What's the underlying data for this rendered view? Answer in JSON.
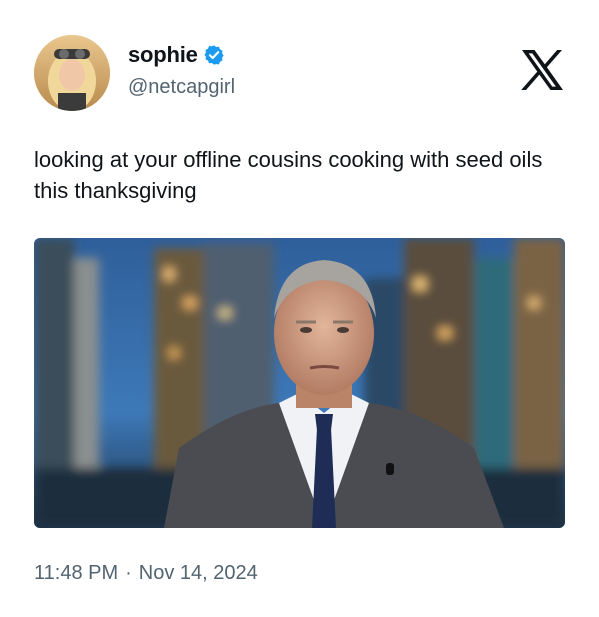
{
  "author": {
    "display_name": "sophie",
    "handle": "@netcapgirl",
    "verified_icon": "verified-badge-icon",
    "avatar_icon": "avatar-image"
  },
  "platform": {
    "logo_icon": "x-logo-icon"
  },
  "tweet": {
    "text": "looking at your offline cousins cooking with seed oils this thanksgiving"
  },
  "media": {
    "type": "photo"
  },
  "meta": {
    "time": "11:48 PM",
    "separator": "·",
    "date": "Nov 14, 2024"
  },
  "colors": {
    "text": "#0f1419",
    "secondary_text": "#536471",
    "verified": "#1d9bf0",
    "background": "#ffffff"
  }
}
